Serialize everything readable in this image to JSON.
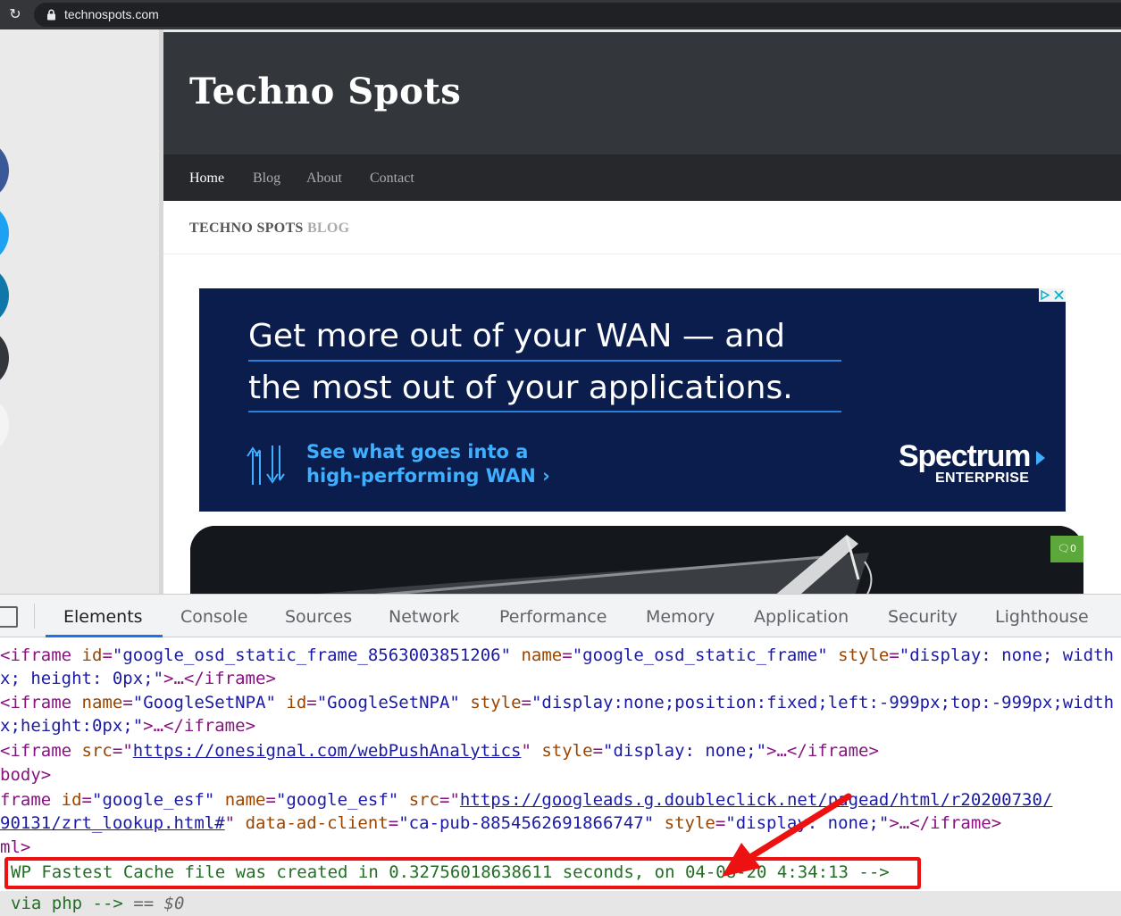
{
  "browser": {
    "url": "technospots.com"
  },
  "site": {
    "title": "Techno Spots",
    "nav": [
      "Home",
      "Blog",
      "About",
      "Contact"
    ],
    "active_nav": "Home",
    "blog_heading_main": "TECHNO SPOTS",
    "blog_heading_sub": "BLOG",
    "comment_count": "0"
  },
  "ad": {
    "headline_line1": "Get more out of your WAN — and",
    "headline_line2": "the most out of your applications.",
    "sub_line1": "See what goes into a",
    "sub_line2": "high-performing WAN ›",
    "brand": "Spectrum",
    "brand_sub": "ENTERPRISE"
  },
  "devtools": {
    "tabs": [
      "Elements",
      "Console",
      "Sources",
      "Network",
      "Performance",
      "Memory",
      "Application",
      "Security",
      "Lighthouse"
    ],
    "active_tab": "Elements",
    "lines": {
      "l1": {
        "open": "<",
        "tag": "iframe",
        "a1": "id",
        "v1": "\"google_osd_static_frame_8563003851206\"",
        "a2": "name",
        "v2": "\"google_osd_static_frame\"",
        "a3": "style",
        "v3": "\"display: none; width"
      },
      "l2": {
        "text": "x; height: 0px;\"",
        "ellipsis": ">…</",
        "tag": "iframe",
        "close": ">"
      },
      "l3": {
        "open": "<",
        "tag": "iframe",
        "a1": "name",
        "v1": "\"GoogleSetNPA\"",
        "a2": "id",
        "v2": "\"GoogleSetNPA\"",
        "a3": "style",
        "v3": "\"display:none;position:fixed;left:-999px;top:-999px;width"
      },
      "l4": {
        "text": "x;height:0px;\"",
        "ellipsis": ">…</",
        "tag": "iframe",
        "close": ">"
      },
      "l5": {
        "open": "<",
        "tag": "iframe",
        "a1": "src",
        "link": "https://onesignal.com/webPushAnalytics",
        "a2": "style",
        "v2": "\"display: none;\"",
        "ellipsis": ">…</",
        "tag2": "iframe",
        "close": ">"
      },
      "l6": {
        "tag": "body",
        "close": ">"
      },
      "l7": {
        "tag": "frame",
        "a1": "id",
        "v1": "\"google_esf\"",
        "a2": "name",
        "v2": "\"google_esf\"",
        "a3": "src",
        "link": "https://googleads.g.doubleclick.net/pagead/html/r20200730/"
      },
      "l8": {
        "link": "90131/zrt_lookup.html#",
        "a1": "data-ad-client",
        "v1": "\"ca-pub-8854562691866747\"",
        "a2": "style",
        "v2": "\"display: none;\"",
        "ellipsis": ">…</",
        "tag": "iframe",
        "close": ">"
      },
      "l9": {
        "tag": "ml",
        "close": ">"
      },
      "l10": {
        "comment": "WP Fastest Cache file was created in 0.32756018638611 seconds, on 04-08-20 4:34:13 -->"
      },
      "l11": {
        "comment": "via php -->",
        "eq": "== $0"
      }
    }
  },
  "colors": {
    "highlight_border": "#ee1111",
    "devtools_accent": "#1a73e8",
    "ad_background": "#0b1d4c"
  }
}
